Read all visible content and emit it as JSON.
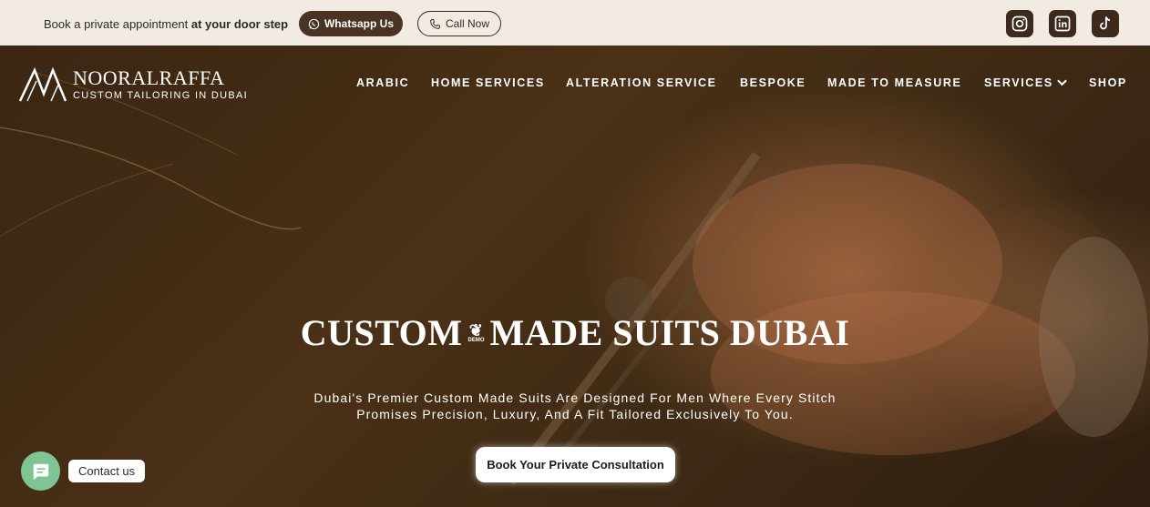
{
  "topbar": {
    "appointment_text": "Book a private appointment ",
    "appointment_bold": "at your door step",
    "whatsapp_label": "Whatsapp Us",
    "call_label": "Call Now",
    "social_icons": [
      "instagram-icon",
      "linkedin-icon",
      "tiktok-icon"
    ]
  },
  "header": {
    "brand": "NOORALRAFFA",
    "tagline": "CUSTOM TAILORING IN DUBAI",
    "nav": [
      {
        "label": "ARABIC"
      },
      {
        "label": "HOME SERVICES"
      },
      {
        "label": "ALTERATION SERVICE"
      },
      {
        "label": "BESPOKE"
      },
      {
        "label": "MADE TO MEASURE"
      },
      {
        "label": "SERVICES",
        "has_dropdown": true
      },
      {
        "label": "SHOP"
      }
    ]
  },
  "hero": {
    "headline_left": "CUSTOM",
    "headline_right": "MADE SUITS DUBAI",
    "separator_badge": "DEMO",
    "subtitle_line1": "Dubai's Premier Custom Made Suits Are Designed For Men Where Every Stitch",
    "subtitle_line2": "Promises Precision, Luxury, And A Fit Tailored Exclusively To You.",
    "cta_label": "Book Your Private Consultation"
  },
  "chat": {
    "label": "Contact us"
  },
  "colors": {
    "topbar_bg": "#f2ebe4",
    "brand_brown": "#4a3322",
    "chat_green": "#7fc493"
  }
}
